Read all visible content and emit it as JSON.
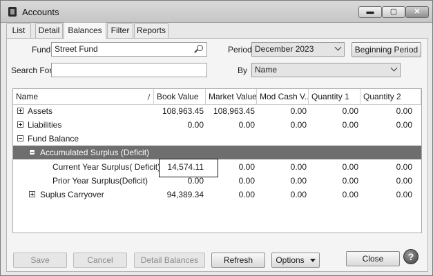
{
  "window": {
    "title": "Accounts",
    "minimize": "▬",
    "maximize": "▢",
    "close": "✕"
  },
  "tabs": [
    {
      "label": "List"
    },
    {
      "label": "Detail"
    },
    {
      "label": "Balances"
    },
    {
      "label": "Filter"
    },
    {
      "label": "Reports"
    }
  ],
  "filters": {
    "fund_label": "Fund",
    "fund_value": "Street Fund",
    "period_label": "Period",
    "period_value": "December 2023",
    "beginning_period_button": "Beginning Period",
    "search_label": "Search For",
    "search_value": "",
    "by_label": "By",
    "by_value": "Name"
  },
  "grid": {
    "columns": [
      "Name",
      "Book Value",
      "Market Value",
      "Mod Cash V...",
      "Quantity 1",
      "Quantity 2"
    ],
    "rows": [
      {
        "name": "Assets",
        "expander": "plus",
        "values": [
          "108,963.45",
          "108,963.45",
          "0.00",
          "0.00",
          "0.00"
        ]
      },
      {
        "name": "Liabilities",
        "expander": "plus",
        "values": [
          "0.00",
          "0.00",
          "0.00",
          "0.00",
          "0.00"
        ]
      },
      {
        "name": "Fund Balance",
        "expander": "minus",
        "values": [
          "",
          "",
          "",
          "",
          ""
        ]
      },
      {
        "name": "Accumulated Surplus (Deficit)",
        "expander": "minus",
        "selected": true,
        "values": [
          "",
          "",
          "",
          "",
          ""
        ]
      },
      {
        "name": "Current Year Surplus( Deficit)",
        "expander": "none",
        "values": [
          "14,574.11",
          "0.00",
          "0.00",
          "0.00",
          "0.00"
        ]
      },
      {
        "name": "Prior Year Surplus(Deficit)",
        "expander": "none",
        "values": [
          "0.00",
          "0.00",
          "0.00",
          "0.00",
          "0.00"
        ]
      },
      {
        "name": "Suplus Carryover",
        "expander": "plus",
        "values": [
          "94,389.34",
          "0.00",
          "0.00",
          "0.00",
          "0.00"
        ]
      }
    ]
  },
  "buttons": {
    "save": "Save",
    "cancel": "Cancel",
    "detail_balances": "Detail Balances",
    "refresh": "Refresh",
    "options": "Options",
    "close": "Close",
    "help": "?"
  }
}
